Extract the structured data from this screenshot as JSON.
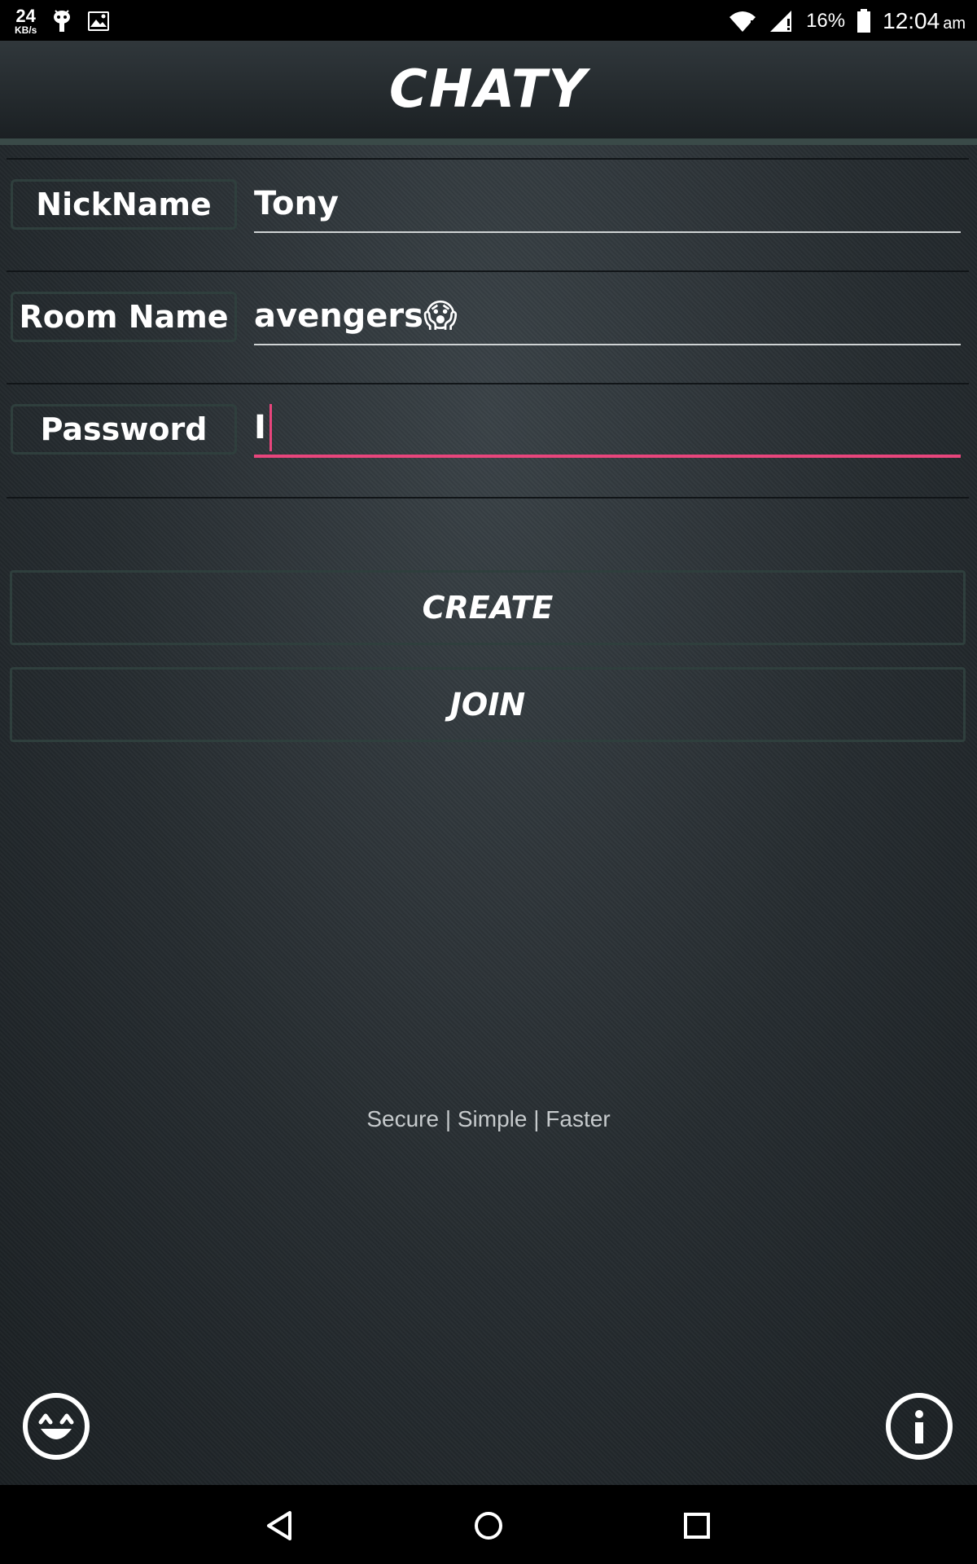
{
  "status_bar": {
    "speed_value": "24",
    "speed_unit": "KB/s",
    "battery_percent": "16%",
    "time": "12:04",
    "ampm": "am"
  },
  "app": {
    "title": "CHATY"
  },
  "form": {
    "nickname_label": "NickName",
    "nickname_value": "Tony",
    "room_label": "Room Name",
    "room_value": "avengers😱",
    "password_label": "Password",
    "password_value": "I"
  },
  "buttons": {
    "create_label": "CREATE",
    "join_label": "JOIN"
  },
  "tagline": "Secure | Simple | Faster",
  "colors": {
    "accent": "#e8457c",
    "frame_border": "#2f3f3d",
    "background": "#23292d"
  },
  "icons": {
    "bottom_left": "emoji-smile-icon",
    "bottom_right": "info-icon"
  }
}
